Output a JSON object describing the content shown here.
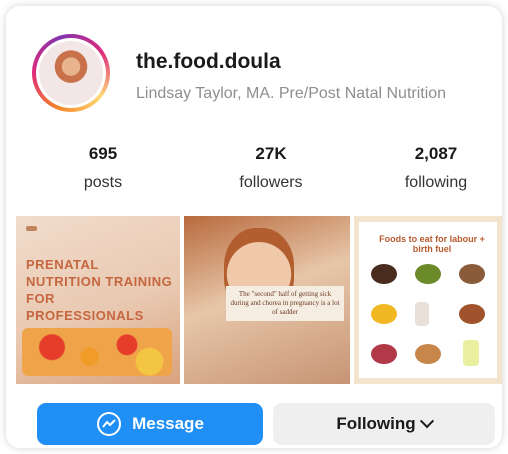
{
  "profile": {
    "username": "the.food.doula",
    "bio": "Lindsay Taylor, MA. Pre/Post Natal Nutrition"
  },
  "stats": {
    "posts": {
      "value": "695",
      "label": "posts"
    },
    "followers": {
      "value": "27K",
      "label": "followers"
    },
    "following": {
      "value": "2,087",
      "label": "following"
    }
  },
  "grid": {
    "post1": {
      "title": "PRENATAL NUTRITION TRAINING FOR PROFESSIONALS"
    },
    "post2": {
      "quote": "The \"second\" half of getting sick during and chorea in pregnancy is a lot of sadder"
    },
    "post3": {
      "title": "Foods to eat for labour + birth fuel"
    }
  },
  "actions": {
    "message_label": "Message",
    "following_label": "Following"
  },
  "colors": {
    "primary_button": "#1f8ff5",
    "secondary_button": "#efefef"
  }
}
